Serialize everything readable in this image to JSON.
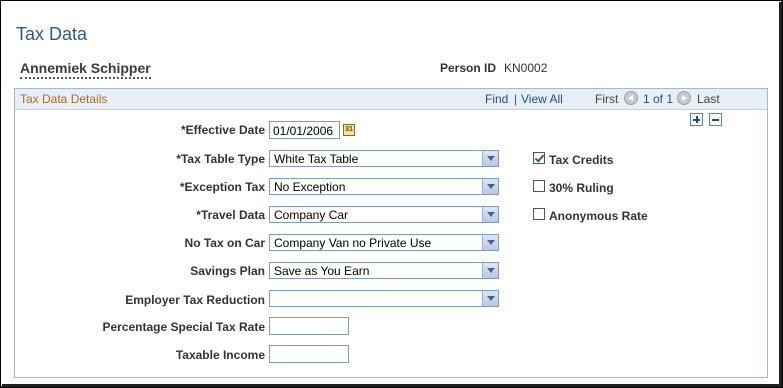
{
  "page": {
    "title": "Tax Data"
  },
  "person": {
    "name": "Annemiek Schipper",
    "id_label": "Person ID",
    "id_value": "KN0002"
  },
  "group": {
    "title": "Tax Data Details",
    "nav": {
      "find": "Find",
      "sep": "|",
      "view_all": "View All",
      "first": "First",
      "counter": "1 of 1",
      "last": "Last"
    }
  },
  "fields": {
    "effective_date": {
      "label": "*Effective Date",
      "value": "01/01/2006"
    },
    "tax_table_type": {
      "label": "*Tax Table Type",
      "value": "White Tax Table"
    },
    "exception_tax": {
      "label": "*Exception Tax",
      "value": "No Exception"
    },
    "travel_data": {
      "label": "*Travel Data",
      "value": "Company Car"
    },
    "no_tax_on_car": {
      "label": "No Tax on Car",
      "value": "Company Van no Private Use"
    },
    "savings_plan": {
      "label": "Savings Plan",
      "value": "Save as You Earn"
    },
    "employer_tax_reduction": {
      "label": "Employer Tax Reduction",
      "value": ""
    },
    "percentage_special_tax_rate": {
      "label": "Percentage Special Tax Rate",
      "value": ""
    },
    "taxable_income": {
      "label": "Taxable Income",
      "value": ""
    }
  },
  "checkboxes": {
    "tax_credits": {
      "label": "Tax Credits",
      "checked": true
    },
    "ruling_30": {
      "label": "30% Ruling",
      "checked": false
    },
    "anonymous_rate": {
      "label": "Anonymous Rate",
      "checked": false
    }
  },
  "icons": {
    "calendar": "calendar-icon",
    "add": "add-row-icon",
    "delete": "delete-row-icon",
    "first": "arrow-left-icon",
    "last": "arrow-right-icon"
  },
  "colors": {
    "title": "#2c5a8c",
    "group_title": "#b56a1a",
    "link": "#1d4f8f"
  }
}
